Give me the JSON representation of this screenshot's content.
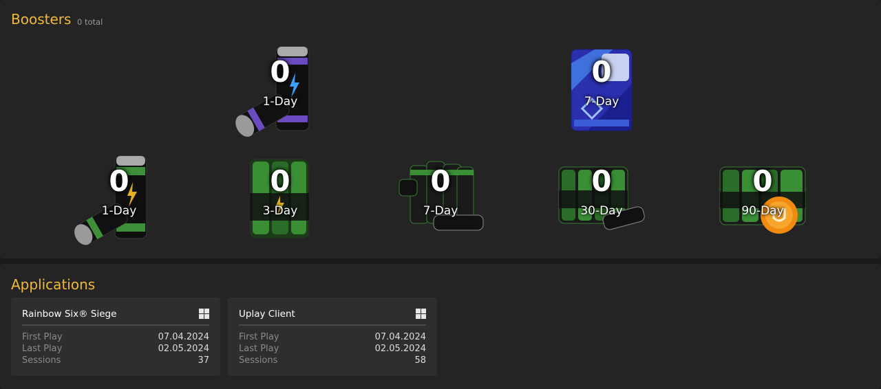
{
  "boosters": {
    "title": "Boosters",
    "total": "0 total",
    "items": [
      {
        "count": "0",
        "label": "1-Day",
        "icon": "purple-energy-can-icon"
      },
      {
        "count": "0",
        "label": "7-Day",
        "icon": "blue-booster-crate-icon"
      },
      {
        "count": "0",
        "label": "1-Day",
        "icon": "green-energy-can-icon"
      },
      {
        "count": "0",
        "label": "3-Day",
        "icon": "green-can-pack-icon"
      },
      {
        "count": "0",
        "label": "7-Day",
        "icon": "green-can-bundle-icon"
      },
      {
        "count": "0",
        "label": "30-Day",
        "icon": "green-can-crate-icon"
      },
      {
        "count": "0",
        "label": "90-Day",
        "icon": "green-can-crate-badge-icon"
      }
    ]
  },
  "applications": {
    "title": "Applications",
    "cards": [
      {
        "name": "Rainbow Six® Siege",
        "platform_icon": "windows-icon",
        "stats": [
          {
            "label": "First Play",
            "value": "07.04.2024"
          },
          {
            "label": "Last Play",
            "value": "02.05.2024"
          },
          {
            "label": "Sessions",
            "value": "37"
          }
        ]
      },
      {
        "name": "Uplay Client",
        "platform_icon": "windows-icon",
        "stats": [
          {
            "label": "First Play",
            "value": "07.04.2024"
          },
          {
            "label": "Last Play",
            "value": "02.05.2024"
          },
          {
            "label": "Sessions",
            "value": "58"
          }
        ]
      }
    ]
  },
  "colors": {
    "accent": "#f0b93a",
    "panel": "#242424",
    "card": "#2e2e2e"
  }
}
